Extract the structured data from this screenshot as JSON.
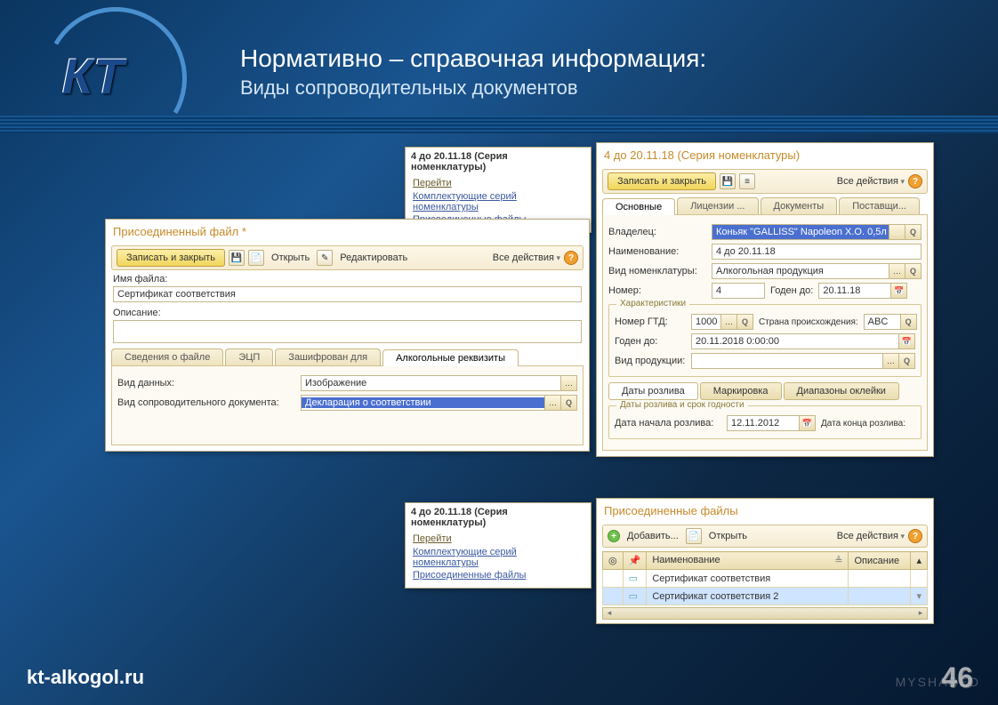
{
  "slide": {
    "title": "Нормативно – справочная информация:",
    "subtitle": "Виды сопроводительных документов",
    "footer": "kt-alkogol.ru",
    "page": "46",
    "watermark": "MYSHARED"
  },
  "panelA": {
    "title": "4 до 20.11.18 (Серия номенклатуры)",
    "go": "Перейти",
    "link1": "Комплектующие серий номенклатуры",
    "link2": "Присоединенные файлы"
  },
  "panelB": {
    "title": "Присоединенный файл *",
    "save_close": "Записать и закрыть",
    "open": "Открыть",
    "edit": "Редактировать",
    "all_actions": "Все действия",
    "filename_label": "Имя файла:",
    "filename": "Сертификат соответствия",
    "desc_label": "Описание:",
    "desc": "",
    "tabs": [
      "Сведения о файле",
      "ЭЦП",
      "Зашифрован для",
      "Алкогольные реквизиты"
    ],
    "data_type_label": "Вид данных:",
    "data_type": "Изображение",
    "doc_type_label": "Вид сопроводительного документа:",
    "doc_type": "Декларация о соответствии"
  },
  "panelC": {
    "title": "4 до 20.11.18 (Серия номенклатуры)",
    "save_close": "Записать и закрыть",
    "all_actions": "Все действия",
    "tabs": [
      "Основные",
      "Лицензии ...",
      "Документы",
      "Поставщи..."
    ],
    "owner_label": "Владелец:",
    "owner": "Коньяк \"GALLISS\" Napoleon X.O. 0,5л",
    "name_label": "Наименование:",
    "name": "4 до 20.11.18",
    "kind_label": "Вид номенклатуры:",
    "kind": "Алкогольная продукция",
    "num_label": "Номер:",
    "num": "4",
    "valid_label": "Годен до:",
    "valid": "20.11.18",
    "char_legend": "Характеристики",
    "gtd_label": "Номер ГТД:",
    "gtd": "1000",
    "country_label": "Страна происхождения:",
    "country": "ABC",
    "valid2_label": "Годен до:",
    "valid2": "20.11.2018 0:00:00",
    "prod_kind_label": "Вид продукции:",
    "prod_kind": "",
    "subtabs": [
      "Даты розлива",
      "Маркировка",
      "Диапазоны оклейки"
    ],
    "pour_legend": "Даты розлива и срок годности",
    "pour_start_label": "Дата начала розлива:",
    "pour_start": "12.11.2012",
    "pour_end_label": "Дата конца розлива:"
  },
  "panelD": {
    "title": "4 до 20.11.18 (Серия номенклатуры)",
    "go": "Перейти",
    "link1": "Комплектующие серий номенклатуры",
    "link2": "Присоединенные файлы"
  },
  "panelE": {
    "title": "Присоединенные файлы",
    "add": "Добавить...",
    "open": "Открыть",
    "all_actions": "Все действия",
    "col_name": "Наименование",
    "col_desc": "Описание",
    "rows": [
      {
        "name": "Сертификат соответствия",
        "desc": ""
      },
      {
        "name": "Сертификат соответствия 2",
        "desc": ""
      }
    ]
  }
}
